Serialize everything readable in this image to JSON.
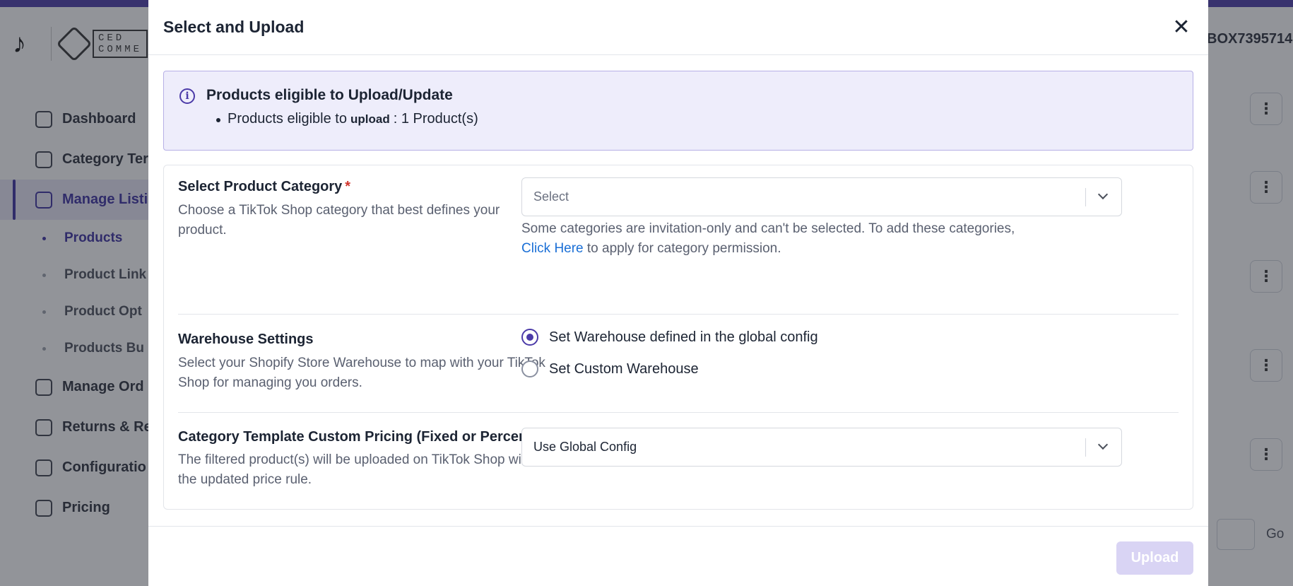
{
  "background": {
    "store_id": "BOX7395714",
    "sidebar": {
      "items": [
        {
          "label": "Dashboard",
          "icon": "home-icon"
        },
        {
          "label": "Category Ter",
          "icon": "grid-icon"
        },
        {
          "label": "Manage Listi",
          "icon": "document-icon",
          "active": true
        },
        {
          "label": "Manage Ord",
          "icon": "box-icon"
        },
        {
          "label": "Returns & Re",
          "icon": "returns-icon"
        },
        {
          "label": "Configuratio",
          "icon": "gear-icon"
        },
        {
          "label": "Pricing",
          "icon": "dollar-icon"
        }
      ],
      "sub_items": [
        {
          "label": "Products",
          "active": true
        },
        {
          "label": "Product Link"
        },
        {
          "label": "Product Opt"
        },
        {
          "label": "Products Bu"
        }
      ]
    },
    "pager_go": "Go",
    "ced_logo_text": "CED\nCOMME"
  },
  "modal": {
    "title": "Select and Upload",
    "close_icon": "close-icon",
    "info": {
      "title": "Products eligible to Upload/Update",
      "item_prefix": "Products eligible to",
      "item_keyword": "upload",
      "item_suffix": ": 1 Product(s)"
    },
    "category": {
      "title": "Select Product Category",
      "required_mark": "*",
      "description": "Choose a TikTok Shop category that best defines your product.",
      "select_placeholder": "Select",
      "helper_text": "Some categories are invitation-only and can't be selected. To add these categories,",
      "helper_link": "Click Here",
      "helper_suffix": "to apply for category permission."
    },
    "warehouse": {
      "title": "Warehouse Settings",
      "description": "Select your Shopify Store Warehouse to map with your TikTok Shop for managing you orders.",
      "options": [
        {
          "label": "Set Warehouse defined in the global config",
          "checked": true
        },
        {
          "label": "Set Custom Warehouse",
          "checked": false
        }
      ]
    },
    "pricing": {
      "title": "Category Template Custom Pricing (Fixed or Percentage)",
      "description": "The filtered product(s) will be uploaded on TikTok Shop with the updated price rule.",
      "select_value": "Use Global Config"
    },
    "upload_label": "Upload"
  },
  "colors": {
    "accent": "#4b3aa8",
    "link": "#1a6fd6",
    "required": "#d0342c",
    "banner_bg": "#eeedfb",
    "upload_disabled_bg": "#d9d4f4"
  }
}
